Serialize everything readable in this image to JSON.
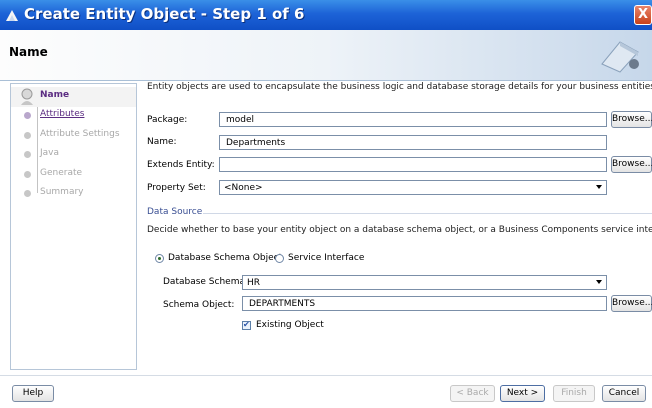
{
  "window": {
    "title": "Create Entity Object - Step 1 of 6",
    "close_glyph": "X"
  },
  "header": {
    "title": "Name"
  },
  "nav": {
    "items": [
      {
        "label": "Name",
        "state": "active"
      },
      {
        "label": "Attributes",
        "state": "link"
      },
      {
        "label": "Attribute Settings",
        "state": "disabled"
      },
      {
        "label": "Java",
        "state": "disabled"
      },
      {
        "label": "Generate",
        "state": "disabled"
      },
      {
        "label": "Summary",
        "state": "disabled"
      }
    ]
  },
  "main": {
    "description": "Entity objects are used to encapsulate the business logic and database storage details for your business entities.",
    "package": {
      "label": "Package:",
      "value": "model"
    },
    "name": {
      "label": "Name:",
      "value": "Departments"
    },
    "extends": {
      "label": "Extends Entity:",
      "value": ""
    },
    "property_set": {
      "label": "Property Set:",
      "value": "<None>"
    },
    "browse_label": "Browse...",
    "data_source": {
      "title": "Data Source",
      "description": "Decide whether to base your entity object on a database schema object, or a Business Components service interface.",
      "option_db": "Database Schema Object",
      "option_service": "Service Interface",
      "schema": {
        "label": "Database Schema:",
        "value": "HR"
      },
      "schema_object": {
        "label": "Schema Object:",
        "value": "DEPARTMENTS"
      },
      "existing_object": "Existing Object"
    }
  },
  "footer": {
    "help": "Help",
    "back": "< Back",
    "next": "Next >",
    "finish": "Finish",
    "cancel": "Cancel"
  },
  "colors": {
    "title_bar": "#1d63d7",
    "nav_active": "#5b2c82",
    "section_title": "#3a4f93"
  }
}
